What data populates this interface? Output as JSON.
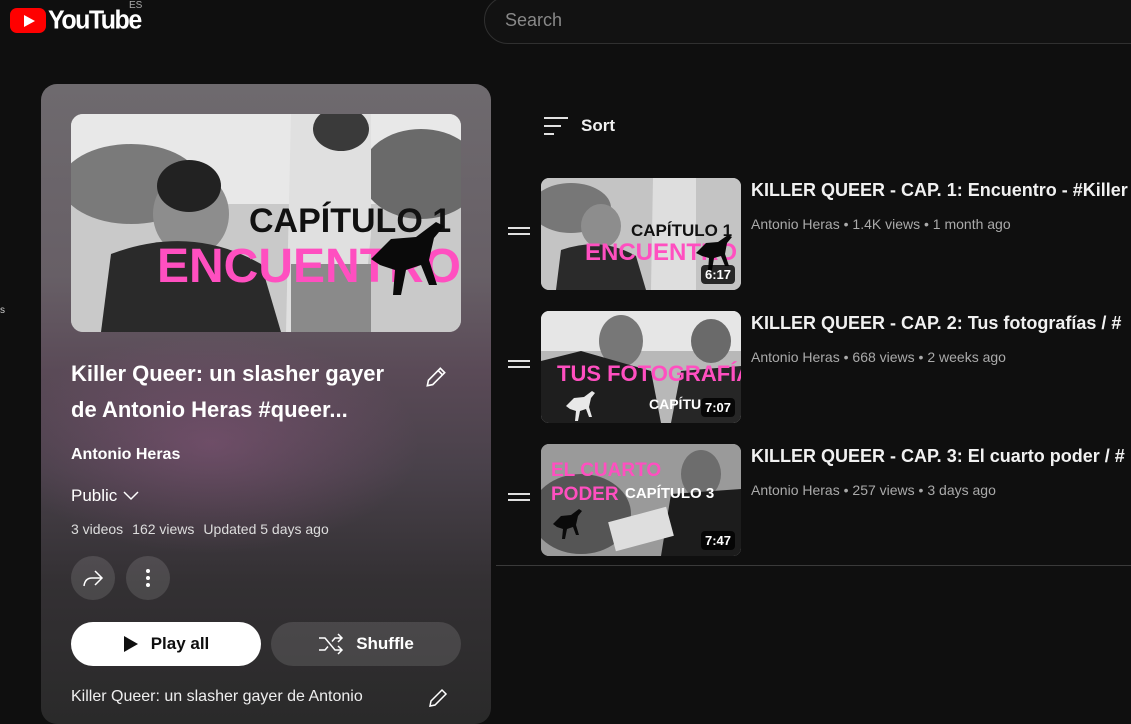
{
  "header": {
    "logo_text": "YouTube",
    "region": "ES",
    "search_placeholder": "Search"
  },
  "edge_text": "s",
  "playlist": {
    "title": "Killer Queer: un slasher gayer de Antonio Heras #queer...",
    "owner": "Antonio Heras",
    "privacy": "Public",
    "stats": [
      "3 videos",
      "162 views",
      "Updated 5 days ago"
    ],
    "play_all_label": "Play all",
    "shuffle_label": "Shuffle",
    "description": "Killer Queer: un slasher gayer de Antonio",
    "hero_caption_top": "CAPÍTULO 1",
    "hero_caption_bottom": "ENCUENTRO"
  },
  "sort_label": "Sort",
  "videos": [
    {
      "title": "KILLER QUEER - CAP. 1: Encuentro - #Killer",
      "channel": "Antonio Heras",
      "views": "1.4K views",
      "age": "1 month ago",
      "duration": "6:17",
      "thumb_top": "CAPÍTULO 1",
      "thumb_bottom": "ENCUENTRO"
    },
    {
      "title": "KILLER QUEER - CAP. 2: Tus fotografías / #",
      "channel": "Antonio Heras",
      "views": "668 views",
      "age": "2 weeks ago",
      "duration": "7:07",
      "thumb_top": "TUS FOTOGRAFÍAS",
      "thumb_bottom": "CAPÍTU"
    },
    {
      "title": "KILLER QUEER - CAP. 3: El cuarto poder / #",
      "channel": "Antonio Heras",
      "views": "257 views",
      "age": "3 days ago",
      "duration": "7:47",
      "thumb_top": "EL CUARTO",
      "thumb_mid": "PODER",
      "thumb_bottom": "CAPÍTULO 3"
    }
  ],
  "colors": {
    "background": "#0f0f0f",
    "brand_red": "#ff0000",
    "thumb_pink": "#ff4fc0",
    "meta_text": "#aaaaaa"
  }
}
